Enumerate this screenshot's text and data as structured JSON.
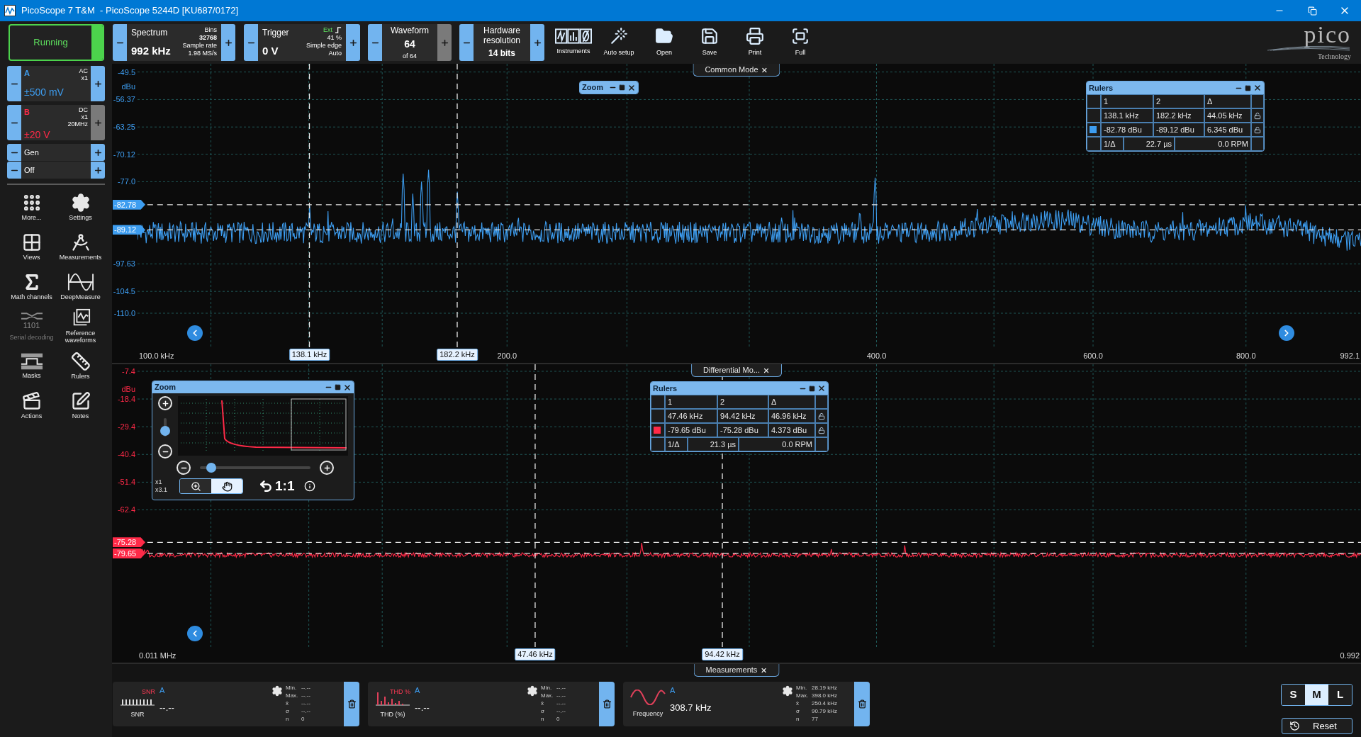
{
  "window": {
    "title": "PicoScope 7 T&M  - PicoScope 5244D [KU687/0172]"
  },
  "toolbar": {
    "run": {
      "label": "Running",
      "running": true
    },
    "spectrum": {
      "title": "Spectrum",
      "value": "992 kHz",
      "bins_label": "Bins",
      "bins": "32768",
      "rate_label": "Sample rate",
      "rate": "1.98 MS/s"
    },
    "trigger": {
      "title": "Trigger",
      "value": "0 V",
      "source": "Ext",
      "pre_trigger": "41 %",
      "type": "Simple edge",
      "mode": "Auto"
    },
    "waveform": {
      "title": "Waveform",
      "value": "64",
      "total": "of 64",
      "plus_disabled": true
    },
    "resolution": {
      "title": "Hardware resolution",
      "value": "14 bits"
    },
    "tools": [
      {
        "kind": "instruments",
        "label": "Instruments"
      },
      {
        "kind": "autosetup",
        "label": "Auto setup"
      },
      {
        "kind": "open",
        "label": "Open"
      },
      {
        "kind": "save",
        "label": "Save"
      },
      {
        "kind": "print",
        "label": "Print"
      },
      {
        "kind": "full",
        "label": "Full"
      }
    ],
    "logo": {
      "name": "pico",
      "tagline": "Technology"
    }
  },
  "channels": [
    {
      "name": "A",
      "color": "#3d9df0",
      "coupling": "AC",
      "probe": "x1",
      "range": "±500 mV",
      "plus_disabled": false
    },
    {
      "name": "B",
      "color": "#ff2a48",
      "coupling": "DC",
      "probe": "x1",
      "bandwidth": "20MHz",
      "range": "±20 V",
      "plus_disabled": true
    }
  ],
  "generator": [
    "Gen",
    "Off"
  ],
  "sidebar": {
    "items": [
      {
        "kind": "more",
        "label": "More...",
        "disabled": false
      },
      {
        "kind": "settings",
        "label": "Settings",
        "disabled": false
      },
      {
        "kind": "views",
        "label": "Views",
        "disabled": false
      },
      {
        "kind": "measurements",
        "label": "Measurements",
        "disabled": false
      },
      {
        "kind": "math",
        "label": "Math channels",
        "disabled": false
      },
      {
        "kind": "deepmeasure",
        "label": "DeepMeasure",
        "disabled": false
      },
      {
        "kind": "serial",
        "label": "Serial decoding",
        "icon_text": "1101",
        "disabled": true
      },
      {
        "kind": "reference",
        "label": "Reference waveforms",
        "disabled": false
      },
      {
        "kind": "masks",
        "label": "Masks",
        "disabled": false
      },
      {
        "kind": "rulers",
        "label": "Rulers",
        "disabled": false
      },
      {
        "kind": "actions",
        "label": "Actions",
        "disabled": false
      },
      {
        "kind": "notes",
        "label": "Notes",
        "disabled": false
      }
    ]
  },
  "views": [
    {
      "tab": "Common Mode",
      "y_unit": "dBu",
      "color": "#3d9df0",
      "y_ticks": [
        "-49.5",
        "-56.37",
        "-63.25",
        "-70.12",
        "-77.0",
        "-97.63",
        "-104.5",
        "-110.0"
      ],
      "y_markers": [
        "-82.78",
        "-89.12"
      ],
      "x_ticks": [
        "100.0 kHz",
        "200.0",
        "400.0",
        "600.0",
        "800.0",
        "992.1"
      ],
      "x_markers": [
        "138.1 kHz",
        "182.2 kHz"
      ],
      "zoom": {
        "title": "Zoom",
        "expanded": false
      },
      "rulers": {
        "title": "Rulers",
        "headers": [
          "1",
          "2",
          "Δ"
        ],
        "rows": [
          [
            "138.1 kHz",
            "182.2 kHz",
            "44.05 kHz"
          ],
          [
            "-82.78 dBu",
            "-89.12 dBu",
            "6.345 dBu"
          ]
        ],
        "inverse": [
          "1/Δ",
          "22.7 µs",
          "0.0 RPM"
        ]
      }
    },
    {
      "tab": "Differential Mo...",
      "y_unit": "dBu",
      "color": "#ff2a48",
      "y_ticks": [
        "-7.4",
        "-18.4",
        "-29.4",
        "-40.4",
        "-51.4",
        "-62.4"
      ],
      "y_markers": [
        "-75.28",
        "-79.65"
      ],
      "x_ticks": [
        "0.011 MHz",
        "0.992"
      ],
      "x_markers": [
        "47.46 kHz",
        "94.42 kHz"
      ],
      "zoom": {
        "title": "Zoom",
        "expanded": true,
        "vertical_slider": {
          "level": 0.3
        },
        "horizontal_slider": {
          "level": 0.1
        },
        "scales": [
          "x1",
          "x3.1"
        ],
        "reset_label": "1:1",
        "tools": [
          {
            "kind": "zoom",
            "selected": false
          },
          {
            "kind": "pan",
            "selected": true
          }
        ]
      },
      "rulers": {
        "title": "Rulers",
        "headers": [
          "1",
          "2",
          "Δ"
        ],
        "rows": [
          [
            "47.46 kHz",
            "94.42 kHz",
            "46.96 kHz"
          ],
          [
            "-79.65 dBu",
            "-75.28 dBu",
            "4.373 dBu"
          ]
        ],
        "inverse": [
          "1/Δ",
          "21.3 µs",
          "0.0 RPM"
        ]
      }
    }
  ],
  "measurements": {
    "tab": "Measurements",
    "items": [
      {
        "kind": "snr",
        "icon_text": "SNR",
        "channel": "A",
        "name": "SNR",
        "value": "--.--",
        "stats": [
          [
            "Min.",
            "--.--"
          ],
          [
            "Max.",
            "--.--"
          ],
          [
            "x̄",
            "--.--"
          ],
          [
            "σ",
            "--.--"
          ],
          [
            "n",
            "0"
          ]
        ]
      },
      {
        "kind": "thd",
        "icon_text": "THD %",
        "channel": "A",
        "name": "THD (%)",
        "value": "--.--",
        "stats": [
          [
            "Min.",
            "--.--"
          ],
          [
            "Max.",
            "--.--"
          ],
          [
            "x̄",
            "--.--"
          ],
          [
            "σ",
            "--.--"
          ],
          [
            "n",
            "0"
          ]
        ]
      },
      {
        "kind": "frequency",
        "channel": "A",
        "name": "Frequency",
        "value": "308.7 kHz",
        "stats": [
          [
            "Min.",
            "28.19 kHz"
          ],
          [
            "Max.",
            "398.0 kHz"
          ],
          [
            "x̄",
            "250.4 kHz"
          ],
          [
            "σ",
            "90.79 kHz"
          ],
          [
            "n",
            "77"
          ]
        ]
      }
    ],
    "sizes": [
      {
        "label": "S",
        "selected": false
      },
      {
        "label": "M",
        "selected": true
      },
      {
        "label": "L",
        "selected": false
      }
    ],
    "reset": "Reset"
  }
}
